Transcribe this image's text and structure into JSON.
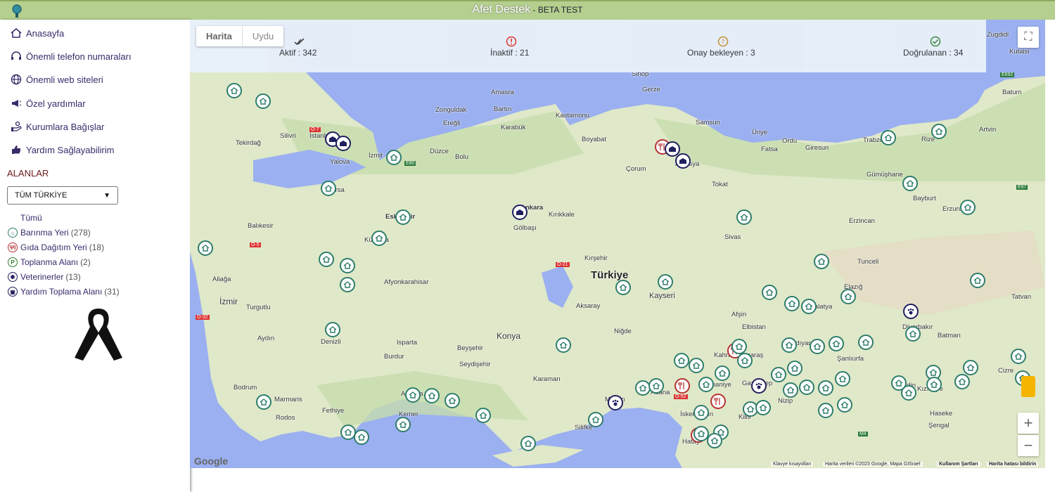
{
  "header": {
    "title": "Afet Destek",
    "beta": " - BETA TEST"
  },
  "nav": {
    "items": [
      {
        "label": "Anasayfa",
        "icon": "home-icon"
      },
      {
        "label": "Önemli telefon numaraları",
        "icon": "headset-icon"
      },
      {
        "label": "Önemli web siteleri",
        "icon": "globe-icon"
      },
      {
        "label": "Özel yardımlar",
        "icon": "megaphone-icon"
      },
      {
        "label": "Kurumlara Bağışlar",
        "icon": "donate-hand-icon"
      },
      {
        "label": "Yardım Sağlayabilirim",
        "icon": "thumbs-up-icon"
      }
    ]
  },
  "areas": {
    "title": "ALANLAR",
    "select_value": "TÜM TÜRKİYE",
    "all_label": "Tümü",
    "categories": [
      {
        "label": "Barınma Yeri",
        "count": "(278)",
        "icon": "shelter-icon",
        "color": "#2e7d6b"
      },
      {
        "label": "Gıda Dağıtım Yeri",
        "count": "(18)",
        "icon": "food-icon",
        "color": "#b83232"
      },
      {
        "label": "Toplanma Alanı",
        "count": "(2)",
        "icon": "parking-icon",
        "color": "#2e7d2e"
      },
      {
        "label": "Veterinerler",
        "count": "(13)",
        "icon": "paw-icon",
        "color": "#1f1f5e"
      },
      {
        "label": "Yardım Toplama Alanı",
        "count": "(31)",
        "icon": "warehouse-icon",
        "color": "#1f1f5e"
      }
    ]
  },
  "stats": {
    "active": "Aktif : 342",
    "inactive": "İnaktif : 21",
    "pending": "Onay bekleyen : 3",
    "verified": "Doğrulanan : 34"
  },
  "map": {
    "type_tabs": [
      "Harita",
      "Uydu"
    ],
    "active_tab": "Harita",
    "zoom_in": "+",
    "zoom_out": "−",
    "logo": "Google",
    "country": "Türkiye",
    "attribution": {
      "shortcuts": "Klavye kısayolları",
      "data": "Harita verileri ©2023 Google, Mapa GISrael",
      "terms": "Kullanım Şartları",
      "report": "Harita hatası bildirin"
    },
    "cities": [
      "İstanbul",
      "Tekirdağ",
      "Silivri",
      "İzmit",
      "Yalova",
      "Bursa",
      "Balıkesir",
      "Eskişehir",
      "Kütahya",
      "Afyonkarahisar",
      "İzmir",
      "Aliağa",
      "Turgutlu",
      "Aydın",
      "Denizli",
      "Isparta",
      "Burdur",
      "Bodrum",
      "Marmaris",
      "Fethiye",
      "Rodos",
      "Antalya",
      "Kemer",
      "Seydişehir",
      "Beyşehir",
      "Konya",
      "Karaman",
      "Silifke",
      "Mersin",
      "Adana",
      "Aksaray",
      "Niğde",
      "Kayseri",
      "Kırşehir",
      "Kırıkkale",
      "Ankara",
      "Gölbaşı",
      "Bolu",
      "Düzce",
      "Zonguldak",
      "Bartın",
      "Amasra",
      "Ereğli",
      "Karabük",
      "Kastamonu",
      "Sinop",
      "Gerze",
      "Boyabat",
      "Samsun",
      "Ünye",
      "Ordu",
      "Fatsa",
      "Giresun",
      "Trabzon",
      "Rize",
      "Artvin",
      "Gümüşhane",
      "Bayburt",
      "Erzincan",
      "Erzurum",
      "Tunceli",
      "Elazığ",
      "Malatya",
      "Tokat",
      "Çorum",
      "Amasya",
      "Sivas",
      "Adıyaman",
      "Kahramanmaraş",
      "Gaziantep",
      "Nizip",
      "Kilis",
      "Hatay",
      "İskenderun",
      "Osmaniye",
      "Şanlıurfa",
      "Batman",
      "Diyarbakır",
      "Mardin",
      "Kızıltepe",
      "Cizre",
      "Tatvan",
      "Haseke",
      "Şengal",
      "Elbistan",
      "Afşin",
      "Batum",
      "Zugdidi",
      "Kutaisi"
    ],
    "road_labels": [
      "O-7",
      "O-5",
      "O-21",
      "O-32",
      "O-52",
      "E80",
      "E692",
      "E97",
      "M4"
    ]
  }
}
